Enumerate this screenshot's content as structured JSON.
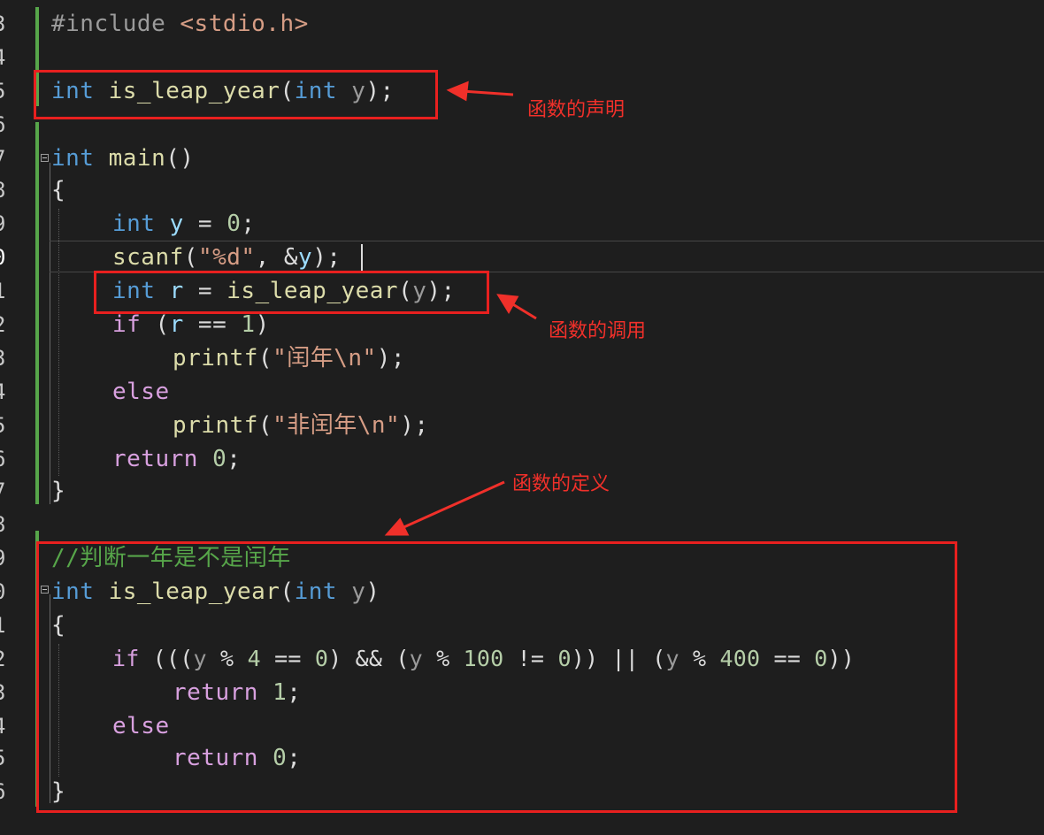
{
  "editor": {
    "line_numbers": [
      "3",
      "4",
      "5",
      "6",
      "7",
      "8",
      "9",
      "0",
      "1",
      "2",
      "3",
      "4",
      "5",
      "6",
      "7",
      "8",
      "9",
      "0",
      "1",
      "2",
      "3",
      "4",
      "5",
      "6"
    ],
    "active_line_index": 7
  },
  "code": {
    "l3": {
      "a": "#include ",
      "b": "<stdio.h>"
    },
    "l5": {
      "kw1": "int",
      "fn": " is_leap_year",
      "p1": "(",
      "kw2": "int",
      "prm": " y",
      "p2": ");"
    },
    "l7": {
      "kw": "int",
      "fn": " main",
      "p": "()"
    },
    "l8": {
      "t": "{"
    },
    "l9": {
      "kw": "int",
      "var": " y",
      "op": " = ",
      "num": "0",
      "end": ";"
    },
    "l10": {
      "fn": "scanf",
      "p1": "(",
      "str": "\"%d\"",
      "p2": ", &",
      "var": "y",
      "p3": ");"
    },
    "l11": {
      "kw": "int",
      "var": " r",
      "op": " = ",
      "fn": "is_leap_year",
      "p1": "(",
      "var2": "y",
      "p2": ");"
    },
    "l12": {
      "ctl": "if",
      "p1": " (",
      "var": "r",
      "op": " == ",
      "num": "1",
      "p2": ")"
    },
    "l13": {
      "fn": "printf",
      "p1": "(",
      "str": "\"闰年\\n\"",
      "p2": ");"
    },
    "l14": {
      "ctl": "else"
    },
    "l15": {
      "fn": "printf",
      "p1": "(",
      "str": "\"非闰年\\n\"",
      "p2": ");"
    },
    "l16": {
      "ctl": "return",
      "num": " 0",
      "end": ";"
    },
    "l17": {
      "t": "}"
    },
    "l19": {
      "cmt": "//判断一年是不是闰年"
    },
    "l20": {
      "kw1": "int",
      "fn": " is_leap_year",
      "p1": "(",
      "kw2": "int",
      "prm": " y",
      "p2": ")"
    },
    "l21": {
      "t": "{"
    },
    "l22": {
      "ctl": "if",
      "a": " (((",
      "y1": "y",
      "b": " % ",
      "n1": "4",
      "c": " == ",
      "n2": "0",
      "d": ") && (",
      "y2": "y",
      "e": " % ",
      "n3": "100",
      "f": " != ",
      "n4": "0",
      "g": ")) || (",
      "y3": "y",
      "h": " % ",
      "n5": "400",
      "i": " == ",
      "n6": "0",
      "j": "))"
    },
    "l23": {
      "ctl": "return",
      "num": " 1",
      "end": ";"
    },
    "l24": {
      "ctl": "else"
    },
    "l25": {
      "ctl": "return",
      "num": " 0",
      "end": ";"
    },
    "l26": {
      "t": "}"
    }
  },
  "annotations": {
    "declaration": "函数的声明",
    "call": "函数的调用",
    "definition": "函数的定义"
  },
  "colors": {
    "keyword": "#569cd6",
    "control": "#d8a0df",
    "function": "#dcdcaa",
    "variable": "#9cdcfe",
    "number": "#b5cea8",
    "string": "#d69d85",
    "comment": "#57a64a",
    "annotation": "#f0302a"
  }
}
